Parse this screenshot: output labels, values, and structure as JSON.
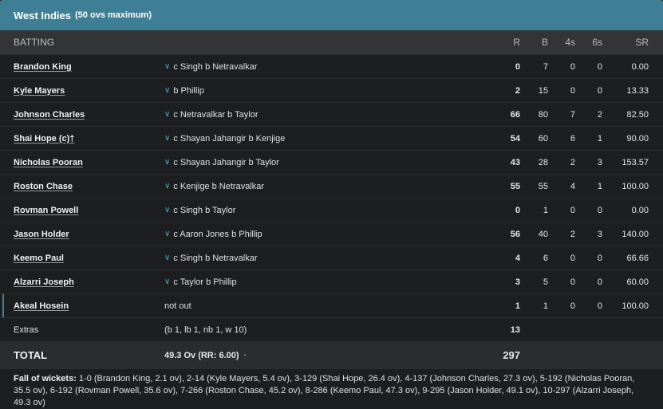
{
  "header": {
    "team": "West Indies",
    "subtitle": "(50 ovs maximum)"
  },
  "columns": {
    "batting": "BATTING",
    "r": "R",
    "b": "B",
    "fours": "4s",
    "sixes": "6s",
    "sr": "SR"
  },
  "batters": [
    {
      "name": "Brandon King",
      "dismissal": "c Singh b Netravalkar",
      "r": "0",
      "b": "7",
      "fours": "0",
      "sixes": "0",
      "sr": "0.00"
    },
    {
      "name": "Kyle Mayers",
      "dismissal": "b Phillip",
      "r": "2",
      "b": "15",
      "fours": "0",
      "sixes": "0",
      "sr": "13.33"
    },
    {
      "name": "Johnson Charles",
      "dismissal": "c Netravalkar b Taylor",
      "r": "66",
      "b": "80",
      "fours": "7",
      "sixes": "2",
      "sr": "82.50"
    },
    {
      "name": "Shai Hope (c)†",
      "dismissal": "c Shayan Jahangir b Kenjige",
      "r": "54",
      "b": "60",
      "fours": "6",
      "sixes": "1",
      "sr": "90.00"
    },
    {
      "name": "Nicholas Pooran",
      "dismissal": "c Shayan Jahangir b Taylor",
      "r": "43",
      "b": "28",
      "fours": "2",
      "sixes": "3",
      "sr": "153.57"
    },
    {
      "name": "Roston Chase",
      "dismissal": "c Kenjige b Netravalkar",
      "r": "55",
      "b": "55",
      "fours": "4",
      "sixes": "1",
      "sr": "100.00"
    },
    {
      "name": "Rovman Powell",
      "dismissal": "c Singh b Taylor",
      "r": "0",
      "b": "1",
      "fours": "0",
      "sixes": "0",
      "sr": "0.00"
    },
    {
      "name": "Jason Holder",
      "dismissal": "c Aaron Jones b Phillip",
      "r": "56",
      "b": "40",
      "fours": "2",
      "sixes": "3",
      "sr": "140.00"
    },
    {
      "name": "Keemo Paul",
      "dismissal": "c Singh b Netravalkar",
      "r": "4",
      "b": "6",
      "fours": "0",
      "sixes": "0",
      "sr": "66.66"
    },
    {
      "name": "Alzarri Joseph",
      "dismissal": "c Taylor b Phillip",
      "r": "3",
      "b": "5",
      "fours": "0",
      "sixes": "0",
      "sr": "60.00"
    },
    {
      "name": "Akeal Hosein",
      "dismissal": "not out",
      "r": "1",
      "b": "1",
      "fours": "0",
      "sixes": "0",
      "sr": "100.00"
    }
  ],
  "extras": {
    "label": "Extras",
    "detail": "(b 1, lb 1, nb 1, w 10)",
    "runs": "13"
  },
  "total": {
    "label": "TOTAL",
    "overs": "49.3 Ov (RR: 6.00)",
    "dot": "·",
    "runs": "297"
  },
  "fall_of_wickets": {
    "label": "Fall of wickets:",
    "text": "1-0 (Brandon King, 2.1 ov), 2-14 (Kyle Mayers, 5.4 ov), 3-129 (Shai Hope, 26.4 ov), 4-137 (Johnson Charles, 27.3 ov), 5-192 (Nicholas Pooran, 35.5 ov), 6-192 (Rovman Powell, 35.6 ov), 7-266 (Roston Chase, 45.2 ov), 8-286 (Keemo Paul, 47.3 ov), 9-295 (Jason Holder, 49.1 ov), 10-297 (Alzarri Joseph, 49.3 ov)"
  },
  "colors": {
    "header_bg": "#3f7f95",
    "body_bg": "#1d1e20",
    "accent": "#5aa7c8"
  },
  "icons": {
    "expand": "chevron-down-icon"
  }
}
